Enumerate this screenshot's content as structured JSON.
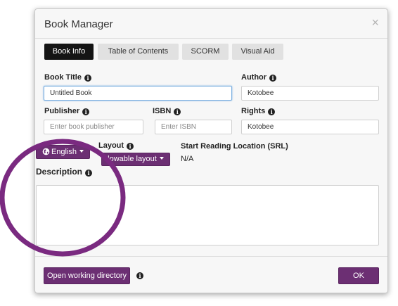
{
  "dialog": {
    "title": "Book Manager",
    "close_symbol": "×"
  },
  "tabs": [
    {
      "label": "Book Info",
      "active": true
    },
    {
      "label": "Table of Contents",
      "active": false
    },
    {
      "label": "SCORM",
      "active": false
    },
    {
      "label": "Visual Aid",
      "active": false
    }
  ],
  "fields": {
    "book_title": {
      "label": "Book Title",
      "value": "Untitled Book"
    },
    "author": {
      "label": "Author",
      "value": "Kotobee"
    },
    "publisher": {
      "label": "Publisher",
      "placeholder": "Enter book publisher"
    },
    "isbn": {
      "label": "ISBN",
      "placeholder": "Enter ISBN"
    },
    "rights": {
      "label": "Rights",
      "value": "Kotobee"
    },
    "layout": {
      "label": "Layout",
      "button": "lowable layout"
    },
    "language": {
      "button": "English"
    },
    "srl": {
      "label": "Start Reading Location (SRL)",
      "value": "N/A"
    },
    "description": {
      "label": "Description"
    }
  },
  "footer": {
    "open_dir": "Open working directory",
    "ok": "OK"
  },
  "icons": {
    "info": "info-icon",
    "globe": "globe-icon",
    "caret": "caret-down-icon"
  },
  "colors": {
    "accent": "#6c2f73",
    "ring": "#7a2a80",
    "active_tab": "#141414"
  }
}
